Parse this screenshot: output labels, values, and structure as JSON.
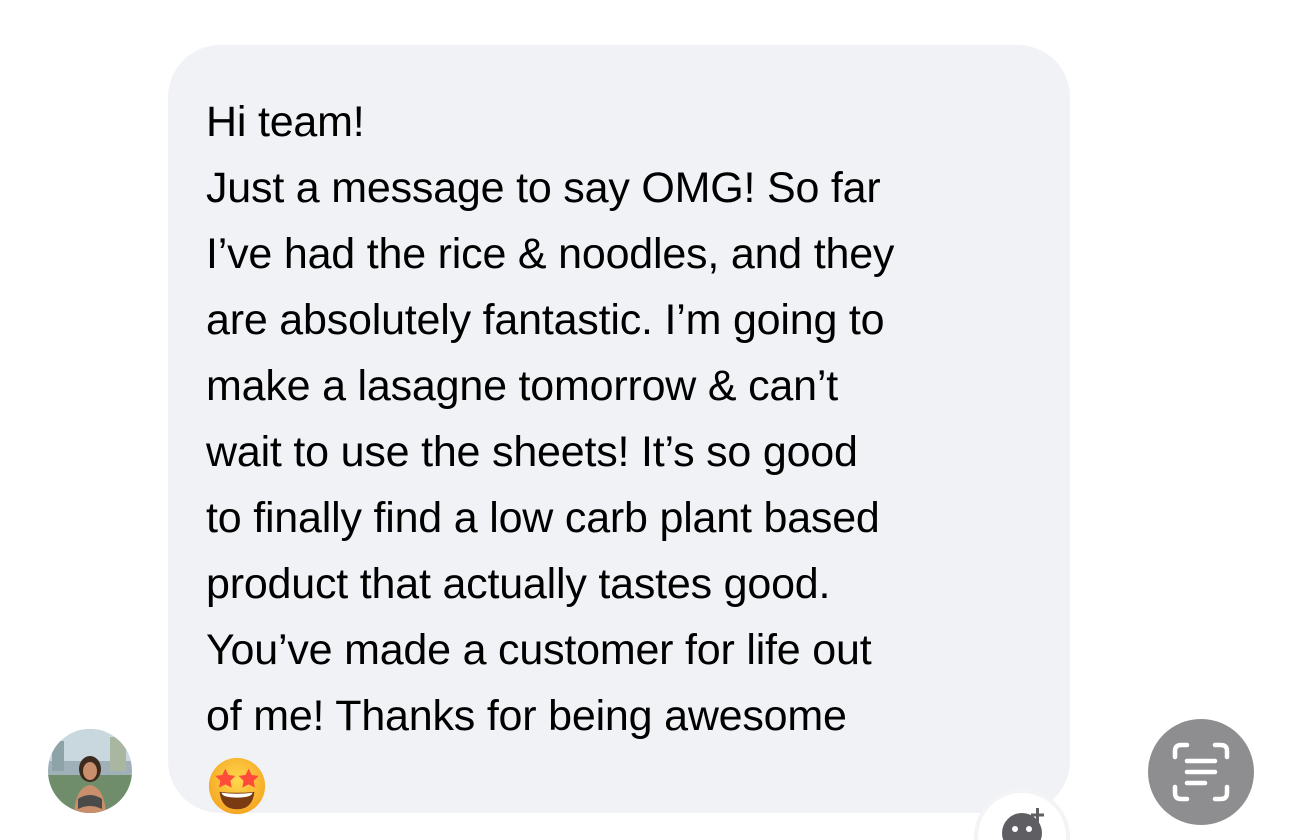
{
  "message": {
    "lines": [
      "Hi team!",
      "Just a message to say OMG! So far",
      "I’ve had the rice & noodles, and they",
      "are absolutely fantastic. I’m going to",
      "make a lasagne tomorrow & can’t",
      "wait to use the sheets! It’s so good",
      "to finally find a low carb plant based",
      "product that actually tastes good.",
      "You’ve made a customer for life out",
      "of me! Thanks for being awesome"
    ],
    "emoji": "star-struck-emoji-icon"
  },
  "sender": {
    "avatar": "sender-avatar"
  },
  "actions": {
    "reaction_icon": "add-reaction-icon",
    "scan_icon": "live-text-scan-icon"
  },
  "colors": {
    "bubble": "#f1f2f6",
    "text": "#000000",
    "scan_button": "#8e8e90"
  }
}
